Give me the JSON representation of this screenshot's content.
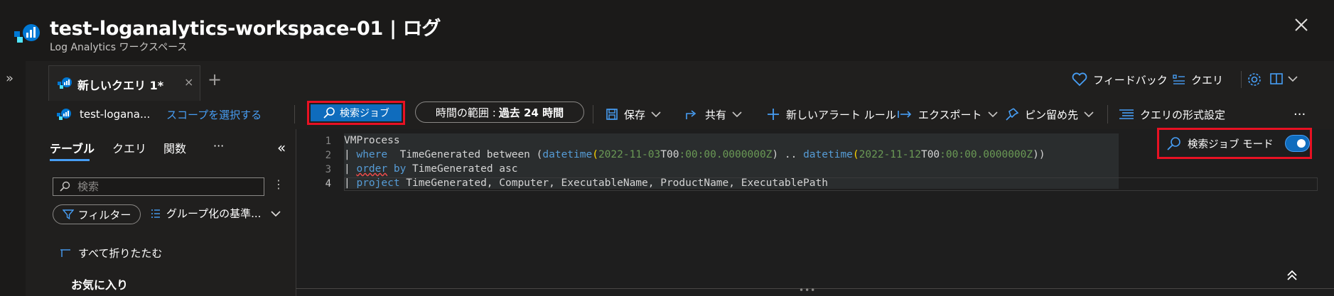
{
  "header": {
    "title": "test-loganalytics-workspace-01 | ログ",
    "subtitle": "Log Analytics ワークスペース",
    "more": "···"
  },
  "side_expand": "»",
  "tabs": {
    "active_label": "新しいクエリ 1*",
    "close": "×",
    "add": "+"
  },
  "right_toolbar": {
    "feedback": "フィードバック",
    "queries": "クエリ"
  },
  "command_bar": {
    "scope_name": "test-logana...",
    "select_scope": "スコープを選択する",
    "search_job": "検索ジョブ",
    "time_range_label": "時間の範囲 :",
    "time_range_value": "過去 24 時間",
    "save": "保存",
    "share": "共有",
    "new_alert": "新しいアラート ルール",
    "export": "エクスポート",
    "pin_to": "ピン留め先",
    "format_query": "クエリの形式設定",
    "more": "···"
  },
  "left_panel": {
    "tabs": [
      "テーブル",
      "クエリ",
      "関数"
    ],
    "more": "···",
    "collapse": "«",
    "search_placeholder": "検索",
    "filter": "フィルター",
    "group_by": "グループ化の基準...",
    "collapse_all": "すべて折りたたむ",
    "favorites": "お気に入り"
  },
  "editor": {
    "line_numbers": [
      "1",
      "2",
      "3",
      "4"
    ],
    "line1": "VMProcess",
    "line2": {
      "pipe": "| ",
      "where": "where",
      "mid": "  TimeGenerated between (",
      "fn1": "datetime",
      "d1a": "2022-11-03",
      "t1": "T00",
      "c1": ":00:00.0000000Z",
      "sep": ") .. ",
      "fn2": "datetime",
      "d2a": "2022-11-12",
      "t2": "T00",
      "c2": ":00:00.0000000Z",
      "end": "))"
    },
    "line3": {
      "pipe": "| ",
      "order": "order",
      "by": " by",
      "rest": " TimeGenerated asc"
    },
    "line4": {
      "pipe": "| ",
      "project": "project",
      "rest": " TimeGenerated, Computer, ExecutableName, ProductName, ExecutablePath"
    }
  },
  "search_job_mode": {
    "label": "検索ジョブ モード",
    "enabled": true
  },
  "colors": {
    "accent": "#0f6cbd",
    "highlight_border": "#e81123",
    "keyword": "#569cd6",
    "string": "#6a9955"
  }
}
